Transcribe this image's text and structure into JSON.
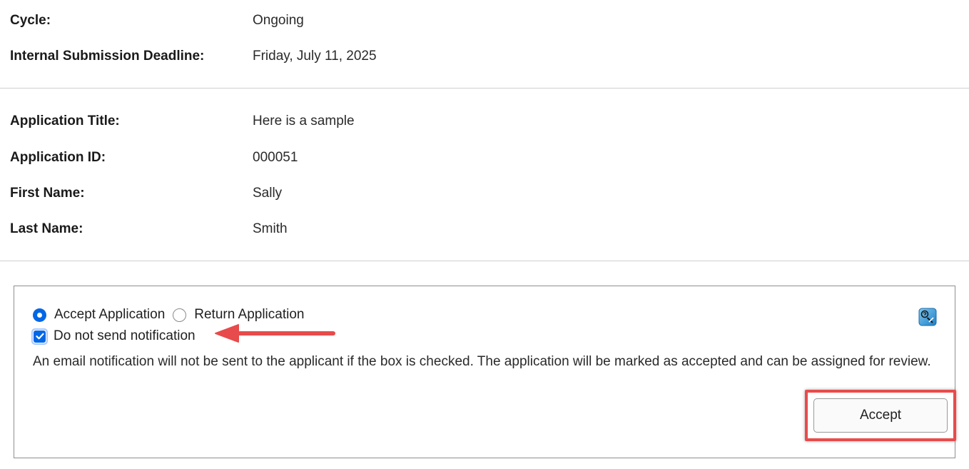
{
  "details": {
    "cycle": {
      "label": "Cycle:",
      "value": "Ongoing"
    },
    "deadline": {
      "label": "Internal Submission Deadline:",
      "value": "Friday, July 11, 2025"
    }
  },
  "application": {
    "title": {
      "label": "Application Title:",
      "value": "Here is a sample"
    },
    "id": {
      "label": "Application ID:",
      "value": "000051"
    },
    "first_name": {
      "label": "First Name:",
      "value": "Sally"
    },
    "last_name": {
      "label": "Last Name:",
      "value": "Smith"
    }
  },
  "decision": {
    "options": [
      {
        "label": "Accept Application",
        "selected": true
      },
      {
        "label": "Return Application",
        "selected": false
      }
    ],
    "notification_checkbox": {
      "label": "Do not send notification",
      "checked": true
    },
    "note": "An email notification will not be sent to the applicant if the box is checked. The application will be marked as accepted and can be assigned for review.",
    "submit_label": "Accept",
    "help_icon": "help-icon"
  },
  "annotations": {
    "arrow_color": "#e84b4b",
    "highlight_color": "#e84b4b"
  }
}
